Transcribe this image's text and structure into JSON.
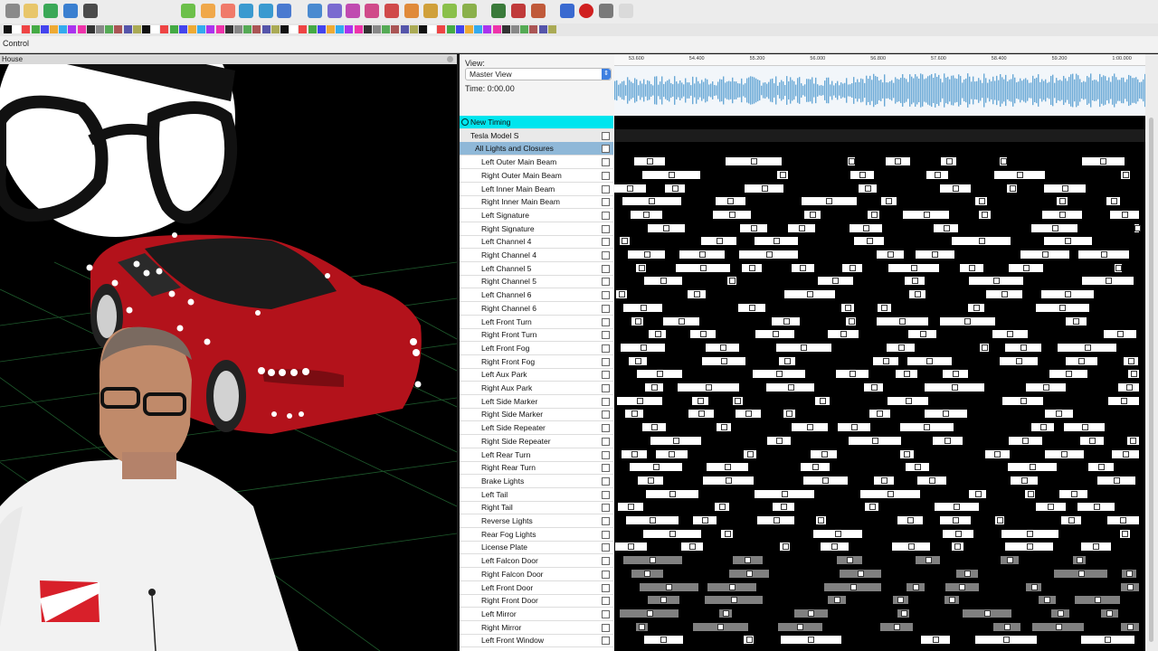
{
  "app": {
    "tabs": [
      "Control"
    ],
    "house_panel_title": "House",
    "toolbar_icons": [
      "folder-icon",
      "new-file-icon",
      "open-icon",
      "save-icon",
      "settings-icon",
      "play-icon",
      "pause-icon",
      "stop-icon",
      "rewind-icon",
      "fast-forward-icon",
      "loop-icon",
      "gear-icon",
      "grid-icon",
      "layers-icon",
      "copy-icon",
      "warning-icon",
      "home-icon",
      "palette-icon",
      "sun-icon",
      "wand-icon",
      "zoom-in-icon",
      "zoom-out-icon",
      "export-icon",
      "help-icon",
      "record-icon",
      "bulb-icon",
      "bulb-off-icon"
    ]
  },
  "sequencer": {
    "view_label": "View:",
    "view_value": "Master View",
    "time_label": "Time: 0:00.00",
    "timeline_ticks": [
      "53.600",
      "54.400",
      "55.200",
      "56.000",
      "56.800",
      "57.600",
      "58.400",
      "59.200",
      "1:00.000"
    ],
    "rows": [
      {
        "label": "New Timing",
        "type": "timing"
      },
      {
        "label": "Tesla Model S",
        "type": "model"
      },
      {
        "label": "All Lights and Closures",
        "type": "group"
      },
      {
        "label": "Left Outer Main Beam",
        "type": "item"
      },
      {
        "label": "Right Outer Main Beam",
        "type": "item"
      },
      {
        "label": "Left Inner Main Beam",
        "type": "item"
      },
      {
        "label": "Right Inner Main Beam",
        "type": "item"
      },
      {
        "label": "Left Signature",
        "type": "item"
      },
      {
        "label": "Right Signature",
        "type": "item"
      },
      {
        "label": "Left Channel 4",
        "type": "item"
      },
      {
        "label": "Right Channel 4",
        "type": "item"
      },
      {
        "label": "Left Channel 5",
        "type": "item"
      },
      {
        "label": "Right Channel 5",
        "type": "item"
      },
      {
        "label": "Left Channel 6",
        "type": "item"
      },
      {
        "label": "Right Channel 6",
        "type": "item"
      },
      {
        "label": "Left Front Turn",
        "type": "item"
      },
      {
        "label": "Right Front Turn",
        "type": "item"
      },
      {
        "label": "Left Front Fog",
        "type": "item"
      },
      {
        "label": "Right Front Fog",
        "type": "item"
      },
      {
        "label": "Left Aux Park",
        "type": "item"
      },
      {
        "label": "Right Aux Park",
        "type": "item"
      },
      {
        "label": "Left Side Marker",
        "type": "item"
      },
      {
        "label": "Right Side Marker",
        "type": "item"
      },
      {
        "label": "Left Side Repeater",
        "type": "item"
      },
      {
        "label": "Right Side Repeater",
        "type": "item"
      },
      {
        "label": "Left Rear Turn",
        "type": "item"
      },
      {
        "label": "Right Rear Turn",
        "type": "item"
      },
      {
        "label": "Brake Lights",
        "type": "item"
      },
      {
        "label": "Left Tail",
        "type": "item"
      },
      {
        "label": "Right Tail",
        "type": "item"
      },
      {
        "label": "Reverse Lights",
        "type": "item"
      },
      {
        "label": "Rear Fog Lights",
        "type": "item"
      },
      {
        "label": "License Plate",
        "type": "item"
      },
      {
        "label": "Left Falcon Door",
        "type": "item"
      },
      {
        "label": "Right Falcon Door",
        "type": "item"
      },
      {
        "label": "Left Front Door",
        "type": "item"
      },
      {
        "label": "Right Front Door",
        "type": "item"
      },
      {
        "label": "Left Mirror",
        "type": "item"
      },
      {
        "label": "Right Mirror",
        "type": "item"
      },
      {
        "label": "Left Front Window",
        "type": "item"
      }
    ]
  },
  "colors": {
    "timing_row": "#00e5ee",
    "group_row": "#8fb8d8",
    "waveform": "#6aa9d6",
    "car_body": "#b3121b"
  }
}
